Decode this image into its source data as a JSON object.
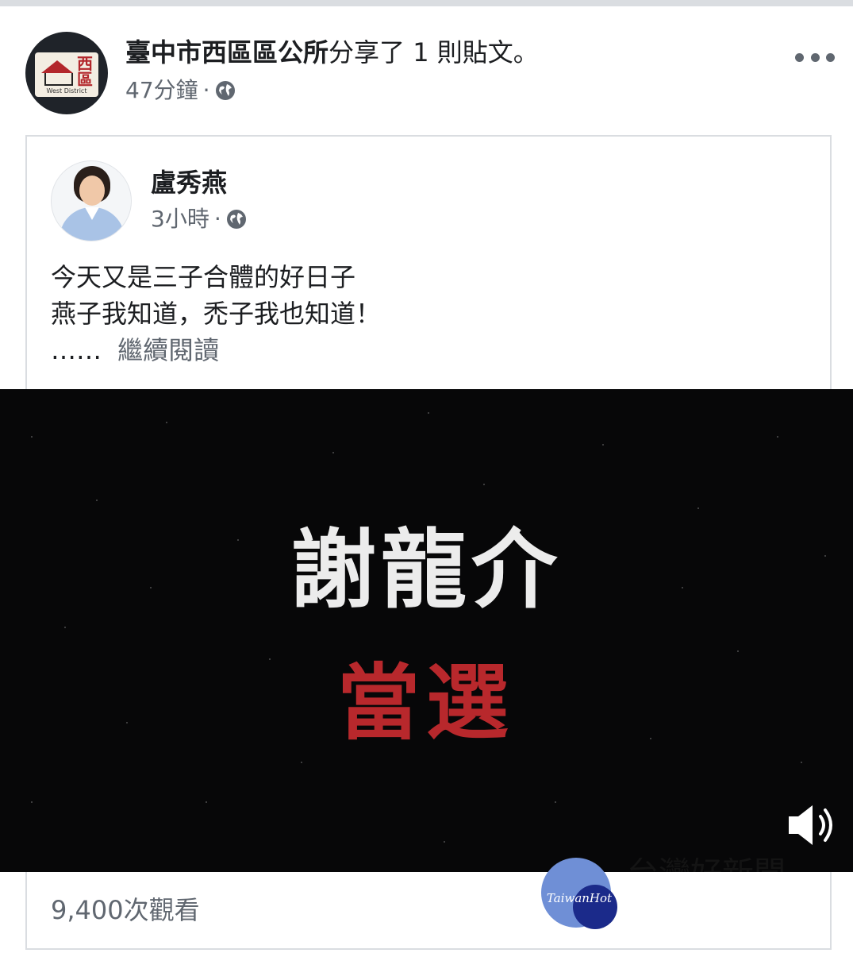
{
  "header": {
    "page_name": "臺中市西區區公所",
    "action_text": "分享了 1 則貼文。",
    "time": "47分鐘",
    "separator": "·",
    "privacy_icon": "globe-icon",
    "more_icon": "more-options-icon"
  },
  "page_avatar": {
    "logo_char": "西區",
    "logo_subtitle": "West District"
  },
  "shared_post": {
    "author_name": "盧秀燕",
    "time": "3小時",
    "separator": "·",
    "privacy_icon": "globe-icon",
    "text_lines": [
      "今天又是三子合體的好日子",
      "燕子我知道，禿子我也知道！"
    ],
    "ellipsis": "……",
    "see_more_label": "繼續閱讀"
  },
  "video": {
    "title": "謝龍介",
    "subtitle": "當選",
    "volume_icon": "volume-on-icon",
    "watermark": "台灣好新聞",
    "colors": {
      "background": "#070708",
      "title": "#ececec",
      "subtitle": "#b8282c"
    }
  },
  "footer": {
    "view_count": "9,400次觀看"
  },
  "site_logo": {
    "text": "TaiwanHot",
    "colors": {
      "back": "#6f8fd6",
      "front": "#1b2a8a"
    }
  }
}
